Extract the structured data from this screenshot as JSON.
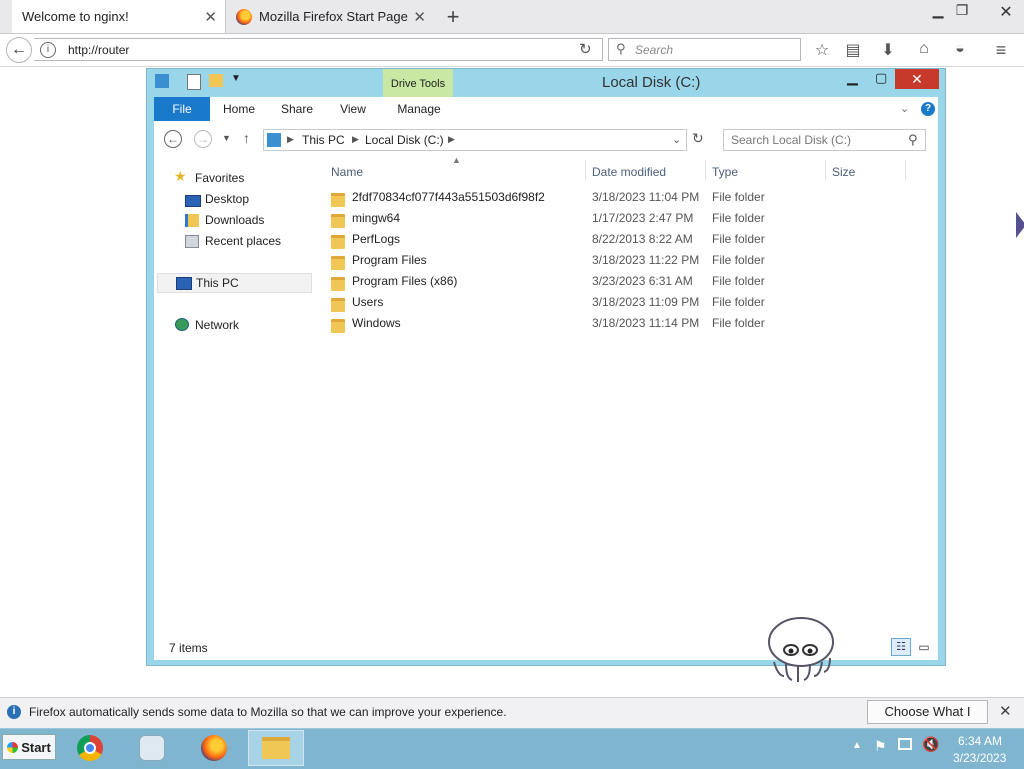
{
  "browser": {
    "tabs": [
      {
        "label": "Welcome to nginx!"
      },
      {
        "label": "Mozilla Firefox Start Page"
      }
    ],
    "url": "http://router",
    "search_placeholder": "Search",
    "notification": {
      "text": "Firefox automatically sends some data to Mozilla so that we can improve your experience.",
      "button": "Choose What I Share"
    }
  },
  "explorer": {
    "title": "Local Disk (C:)",
    "context_tab": "Drive Tools",
    "ribbon_tabs": [
      "File",
      "Home",
      "Share",
      "View",
      "Manage"
    ],
    "breadcrumb": [
      "This PC",
      "Local Disk (C:)"
    ],
    "search_placeholder": "Search Local Disk (C:)",
    "columns": {
      "name": "Name",
      "date": "Date modified",
      "type": "Type",
      "size": "Size"
    },
    "nav": {
      "favorites": "Favorites",
      "desktop": "Desktop",
      "downloads": "Downloads",
      "recent": "Recent places",
      "thispc": "This PC",
      "network": "Network"
    },
    "files": [
      {
        "name": "2fdf70834cf077f443a551503d6f98f2",
        "date": "3/18/2023 11:04 PM",
        "type": "File folder"
      },
      {
        "name": "mingw64",
        "date": "1/17/2023 2:47 PM",
        "type": "File folder"
      },
      {
        "name": "PerfLogs",
        "date": "8/22/2013 8:22 AM",
        "type": "File folder"
      },
      {
        "name": "Program Files",
        "date": "3/18/2023 11:22 PM",
        "type": "File folder"
      },
      {
        "name": "Program Files (x86)",
        "date": "3/23/2023 6:31 AM",
        "type": "File folder"
      },
      {
        "name": "Users",
        "date": "3/18/2023 11:09 PM",
        "type": "File folder"
      },
      {
        "name": "Windows",
        "date": "3/18/2023 11:14 PM",
        "type": "File folder"
      }
    ],
    "status": "7 items"
  },
  "taskbar": {
    "start": "Start",
    "time": "6:34 AM",
    "date": "3/23/2023"
  },
  "icons": [
    "back-icon",
    "info-icon",
    "reload-icon",
    "search-icon",
    "star-icon",
    "reading-list-icon",
    "download-icon",
    "home-icon",
    "pocket-icon",
    "menu-icon",
    "folder-icon",
    "computer-icon",
    "network-icon",
    "flag-icon",
    "speaker-muted-icon"
  ],
  "colors": {
    "explorer_frame": "#99d6ea",
    "file_tab": "#1979ca",
    "close": "#c7392a",
    "taskbar": "#7fb5cf"
  }
}
